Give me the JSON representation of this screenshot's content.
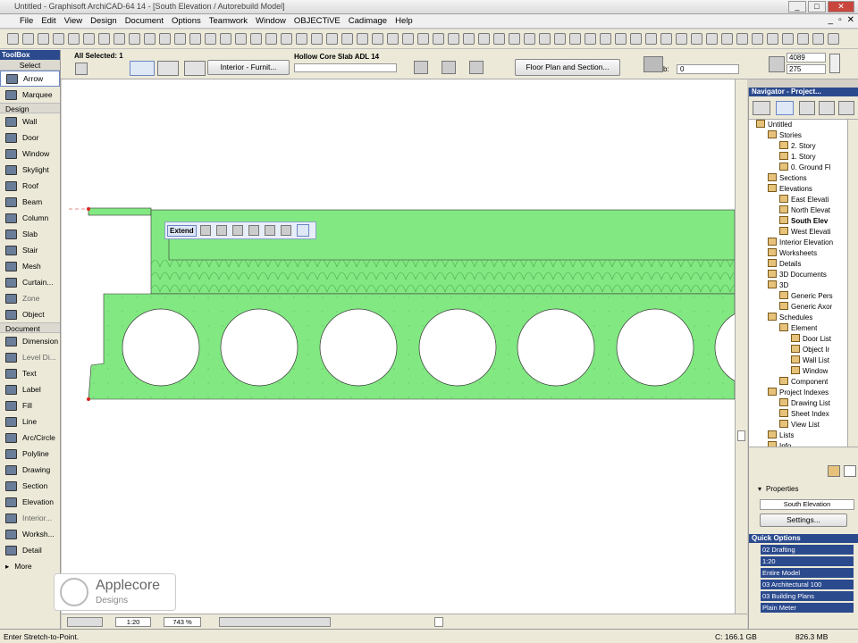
{
  "window": {
    "title": "Untitled - Graphisoft ArchiCAD-64 14 - [South Elevation / Autorebuild Model]"
  },
  "menu": [
    "File",
    "Edit",
    "View",
    "Design",
    "Document",
    "Options",
    "Teamwork",
    "Window",
    "OBJECTiVE",
    "Cadimage",
    "Help"
  ],
  "info_box": {
    "selected": "All Selected: 1",
    "layer": "Interior - Furnit...",
    "object_name": "Hollow Core Slab ADL 14",
    "view_button": "Floor Plan and Section...",
    "b_label": "b:",
    "b_value": "0",
    "dim1": "4089",
    "dim2": "275"
  },
  "toolbox": {
    "title": "ToolBox",
    "select_label": "Select",
    "select_items": [
      "Arrow",
      "Marquee"
    ],
    "design_label": "Design",
    "design_items": [
      "Wall",
      "Door",
      "Window",
      "Skylight",
      "Roof",
      "Beam",
      "Column",
      "Slab",
      "Stair",
      "Mesh",
      "Curtain...",
      "Zone",
      "Object"
    ],
    "document_label": "Document",
    "document_items": [
      "Dimension",
      "Level Di...",
      "Text",
      "Label",
      "Fill",
      "Line",
      "Arc/Circle",
      "Polyline",
      "Drawing",
      "Section",
      "Elevation",
      "Interior...",
      "Worksh...",
      "Detail"
    ],
    "more_label": "More"
  },
  "canvas": {
    "popup_label": "Extend",
    "slab_color": "#82e882",
    "scale": "1:20",
    "zoom": "743 %"
  },
  "navigator": {
    "title": "Navigator - Project...",
    "tree": [
      {
        "label": "Untitled",
        "level": 0,
        "bold": false
      },
      {
        "label": "Stories",
        "level": 1,
        "bold": false
      },
      {
        "label": "2. Story",
        "level": 2,
        "bold": false
      },
      {
        "label": "1. Story",
        "level": 2,
        "bold": false
      },
      {
        "label": "0. Ground Fl",
        "level": 2,
        "bold": false
      },
      {
        "label": "Sections",
        "level": 1,
        "bold": false
      },
      {
        "label": "Elevations",
        "level": 1,
        "bold": false
      },
      {
        "label": "East Elevati",
        "level": 2,
        "bold": false
      },
      {
        "label": "North Elevat",
        "level": 2,
        "bold": false
      },
      {
        "label": "South Elev",
        "level": 2,
        "bold": true
      },
      {
        "label": "West Elevati",
        "level": 2,
        "bold": false
      },
      {
        "label": "Interior Elevation",
        "level": 1,
        "bold": false
      },
      {
        "label": "Worksheets",
        "level": 1,
        "bold": false
      },
      {
        "label": "Details",
        "level": 1,
        "bold": false
      },
      {
        "label": "3D Documents",
        "level": 1,
        "bold": false
      },
      {
        "label": "3D",
        "level": 1,
        "bold": false
      },
      {
        "label": "Generic Pers",
        "level": 2,
        "bold": false
      },
      {
        "label": "Generic Axor",
        "level": 2,
        "bold": false
      },
      {
        "label": "Schedules",
        "level": 1,
        "bold": false
      },
      {
        "label": "Element",
        "level": 2,
        "bold": false
      },
      {
        "label": "Door List",
        "level": 3,
        "bold": false
      },
      {
        "label": "Object Ir",
        "level": 3,
        "bold": false
      },
      {
        "label": "Wall List",
        "level": 3,
        "bold": false
      },
      {
        "label": "Window",
        "level": 3,
        "bold": false
      },
      {
        "label": "Component",
        "level": 2,
        "bold": false
      },
      {
        "label": "Project Indexes",
        "level": 1,
        "bold": false
      },
      {
        "label": "Drawing List",
        "level": 2,
        "bold": false
      },
      {
        "label": "Sheet Index",
        "level": 2,
        "bold": false
      },
      {
        "label": "View List",
        "level": 2,
        "bold": false
      },
      {
        "label": "Lists",
        "level": 1,
        "bold": false
      },
      {
        "label": "Info",
        "level": 1,
        "bold": false
      }
    ],
    "properties_label": "Properties",
    "properties_value": "South Elevation",
    "settings_button": "Settings..."
  },
  "quick_options": {
    "title": "Quick Options",
    "rows": [
      "02 Drafting",
      "1:20",
      "Entire Model",
      "03 Architectural 100",
      "03 Building Plans",
      "Plain Meter"
    ]
  },
  "status": {
    "message": "Enter Stretch-to-Point.",
    "disk": "C: 166.1 GB",
    "ram": "826.3 MB"
  },
  "logo": {
    "name": "Applecore",
    "sub": "Designs"
  }
}
